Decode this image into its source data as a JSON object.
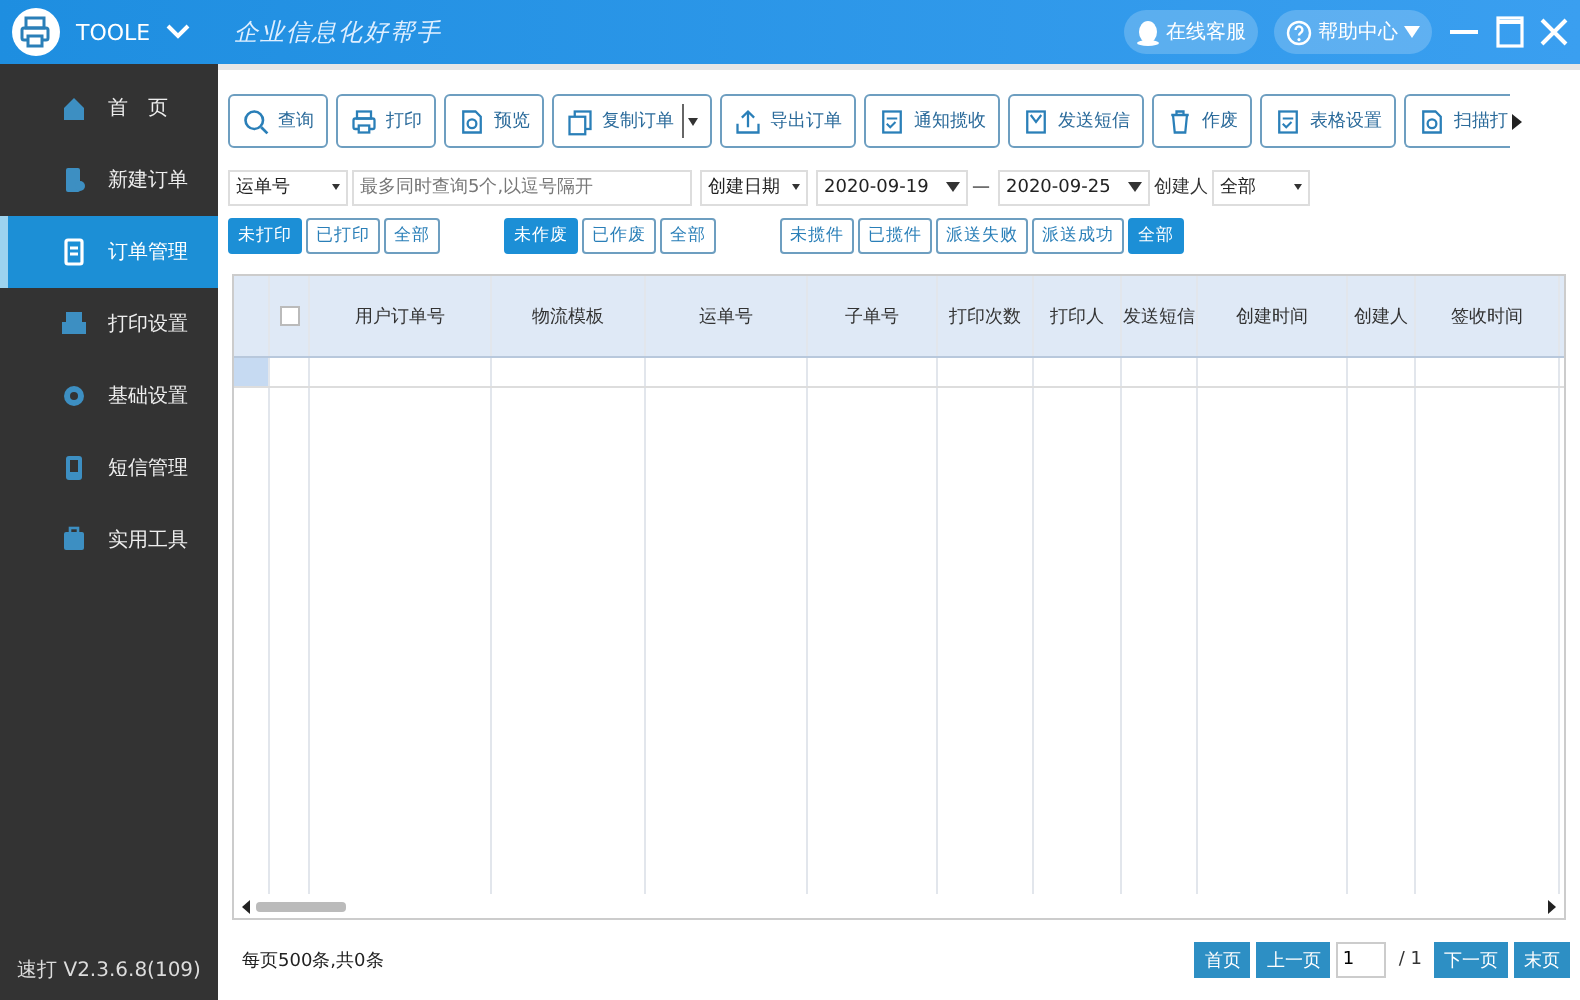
{
  "header": {
    "app_name": "TOOLE",
    "slogan": "企业信息化好帮手",
    "service_button": "在线客服",
    "help_button": "帮助中心"
  },
  "sidebar": {
    "items": [
      {
        "label": "首　页",
        "selected": false
      },
      {
        "label": "新建订单",
        "selected": false
      },
      {
        "label": "订单管理",
        "selected": true
      },
      {
        "label": "打印设置",
        "selected": false
      },
      {
        "label": "基础设置",
        "selected": false
      },
      {
        "label": "短信管理",
        "selected": false
      },
      {
        "label": "实用工具",
        "selected": false
      }
    ],
    "version": "速打 V2.3.6.8(109)"
  },
  "toolbar": [
    {
      "label": "查询",
      "dropdown": false
    },
    {
      "label": "打印",
      "dropdown": false
    },
    {
      "label": "预览",
      "dropdown": false
    },
    {
      "label": "复制订单",
      "dropdown": true
    },
    {
      "label": "导出订单",
      "dropdown": false
    },
    {
      "label": "通知揽收",
      "dropdown": false
    },
    {
      "label": "发送短信",
      "dropdown": false
    },
    {
      "label": "作废",
      "dropdown": false
    },
    {
      "label": "表格设置",
      "dropdown": false
    },
    {
      "label": "扫描打",
      "dropdown": false
    }
  ],
  "filters": {
    "search_type": "运单号",
    "search_placeholder": "最多同时查询5个,以逗号隔开",
    "date_type": "创建日期",
    "date_from": "2020-09-19",
    "date_separator": "—",
    "date_to": "2020-09-25",
    "creator_label": "创建人",
    "creator": "全部"
  },
  "toggle_groups": [
    [
      {
        "label": "未打印",
        "selected": true
      },
      {
        "label": "已打印",
        "selected": false
      },
      {
        "label": "全部",
        "selected": false
      }
    ],
    [
      {
        "label": "未作废",
        "selected": true
      },
      {
        "label": "已作废",
        "selected": false
      },
      {
        "label": "全部",
        "selected": false
      }
    ],
    [
      {
        "label": "未揽件",
        "selected": false
      },
      {
        "label": "已揽件",
        "selected": false
      },
      {
        "label": "派送失败",
        "selected": false
      },
      {
        "label": "派送成功",
        "selected": false
      },
      {
        "label": "全部",
        "selected": true
      }
    ]
  ],
  "table": {
    "select_all_checked": false,
    "columns": [
      "用户订单号",
      "物流模板",
      "运单号",
      "子单号",
      "打印次数",
      "打印人",
      "发送短信",
      "创建时间",
      "创建人",
      "签收时间"
    ]
  },
  "footer": {
    "summary": "每页500条,共0条",
    "first": "首页",
    "prev": "上一页",
    "page": "1",
    "total": "/ 1",
    "next": "下一页",
    "last": "末页"
  }
}
